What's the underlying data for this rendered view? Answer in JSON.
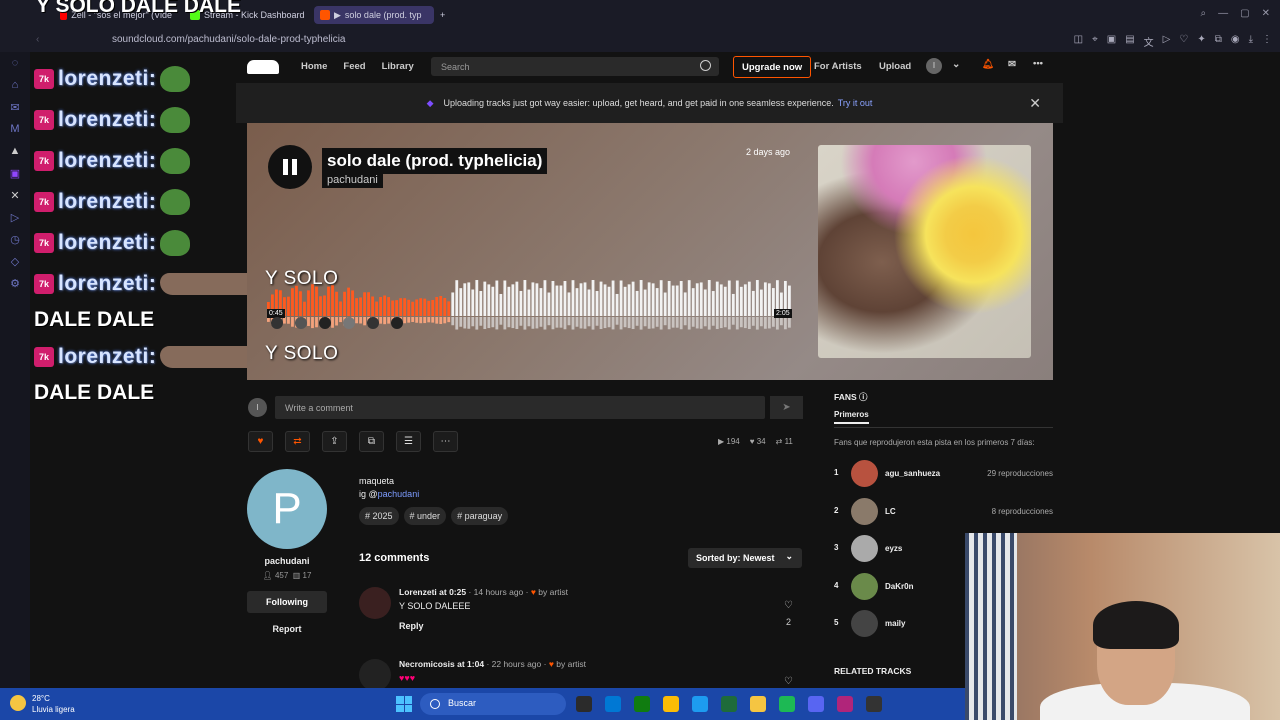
{
  "browser": {
    "tabs": [
      {
        "label": "Zell - \"sos el mejor\" (Vide",
        "color": "#ff0000"
      },
      {
        "label": "Stream - Kick Dashboard",
        "color": "#53fc18"
      },
      {
        "label": "solo dale (prod. typ",
        "color": "#ff5500"
      }
    ],
    "new_tab": "+",
    "url": "soundcloud.com/pachudani/solo-dale-prod-typhelicia"
  },
  "chat": {
    "username": "lorenzeti:",
    "messages": [
      "DALE DALE",
      "DALE DALE"
    ],
    "overlay_top": "Y SOLO DALE DALE"
  },
  "sc": {
    "nav": {
      "home": "Home",
      "feed": "Feed",
      "library": "Library"
    },
    "search_placeholder": "Search",
    "upgrade": "Upgrade now",
    "for_artists": "For Artists",
    "upload": "Upload",
    "avatar_letter": "I",
    "banner_text": "Uploading tracks just got way easier: upload, get heard, and get paid in one seamless experience.",
    "banner_link": "Try it out",
    "banner_close": "✕"
  },
  "track": {
    "title": "solo dale (prod. typhelicia)",
    "artist": "pachudani",
    "date": "2 days ago",
    "current_time": "0:45",
    "duration": "2:05",
    "progress": 0.35,
    "overlay_1": "Y SOLO",
    "overlay_2": "Y SOLO"
  },
  "comment_input": {
    "placeholder": "Write a comment",
    "avatar": "I"
  },
  "stats": {
    "plays": "194",
    "likes": "34",
    "reposts": "11"
  },
  "uploader": {
    "initial": "P",
    "name": "pachudani",
    "followers": "457",
    "tracks": "17",
    "follow_label": "Following",
    "report_label": "Report"
  },
  "description": {
    "line1": "maqueta",
    "line2_prefix": "ig @",
    "line2_link": "pachudani",
    "tags": [
      "# 2025",
      "# under",
      "# paraguay"
    ]
  },
  "comments": {
    "count_label": "12 comments",
    "sort_label": "Sorted by: Newest",
    "items": [
      {
        "user": "Lorenzeti",
        "at": "at 0:25",
        "when": "· 14 hours ago ·",
        "by": "by artist",
        "text": "Y SOLO DALEEE",
        "reply": "Reply",
        "likes": "2"
      },
      {
        "user": "Necromicosis",
        "at": "at 1:04",
        "when": "· 22 hours ago ·",
        "by": "by artist",
        "text": "",
        "reply": "",
        "likes": ""
      }
    ]
  },
  "fans": {
    "heading": "FANS",
    "tab": "Primeros",
    "desc": "Fans que reprodujeron esta pista en los primeros 7 días:",
    "items": [
      {
        "rank": "1",
        "name": "agu_sanhueza",
        "plays": "29 reproducciones",
        "color": "#b8523f"
      },
      {
        "rank": "2",
        "name": "LC",
        "plays": "8 reproducciones",
        "color": "#8a7a6a"
      },
      {
        "rank": "3",
        "name": "eyzs",
        "plays": "",
        "color": "#aaaaaa"
      },
      {
        "rank": "4",
        "name": "DaKr0n",
        "plays": "",
        "color": "#6a8a4a"
      },
      {
        "rank": "5",
        "name": "maily",
        "plays": "",
        "color": "#444444"
      }
    ],
    "related": "RELATED TRACKS"
  },
  "taskbar": {
    "temp": "28°C",
    "weather": "Lluvia ligera",
    "search": "Buscar",
    "icons": [
      "#2b2b2b",
      "#0078d4",
      "#107c10",
      "#fbbc05",
      "#1d9bf0",
      "#1e6b3a",
      "#f5c542",
      "#1db954",
      "#5865f2",
      "#b0257a",
      "#333"
    ]
  }
}
